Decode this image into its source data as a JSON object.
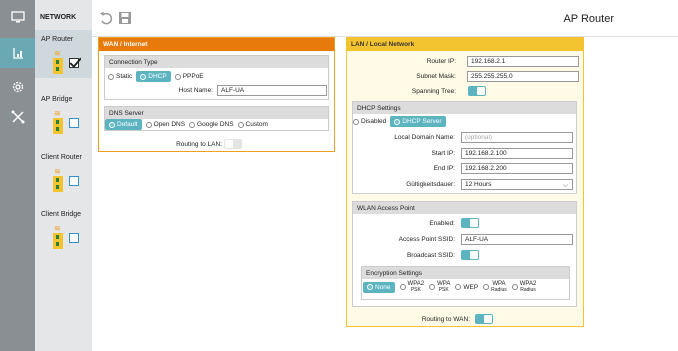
{
  "app_title": "AP Router",
  "icons": {
    "rail": [
      "monitor-icon",
      "network-icon",
      "settings-gear-icon",
      "tools-icon"
    ],
    "toolbar": [
      "undo-icon",
      "save-icon"
    ]
  },
  "sidebar": {
    "title": "NETWORK",
    "modes": [
      {
        "label": "AP Router",
        "checked": true
      },
      {
        "label": "AP Bridge",
        "checked": false
      },
      {
        "label": "Client Router",
        "checked": false
      },
      {
        "label": "Client Bridge",
        "checked": false
      }
    ]
  },
  "wan": {
    "header": "WAN / Internet",
    "connection_type": {
      "title": "Connection Type",
      "options": [
        "Static",
        "DHCP",
        "PPPoE"
      ],
      "selected": "DHCP",
      "host_name_label": "Host Name:",
      "host_name_value": "ALF-UA"
    },
    "dns": {
      "title": "DNS Server",
      "options": [
        "Default",
        "Open DNS",
        "Google DNS",
        "Custom"
      ],
      "selected": "Default"
    },
    "routing_label": "Routing to LAN:",
    "routing_on": false
  },
  "lan": {
    "header": "LAN / Local Network",
    "router_ip_label": "Router IP:",
    "router_ip": "192.168.2.1",
    "subnet_label": "Subnet Mask:",
    "subnet": "255.255.255.0",
    "spanning_label": "Spanning Tree:",
    "spanning_on": true,
    "dhcp": {
      "title": "DHCP Settings",
      "options": [
        "Disabled",
        "DHCP Server"
      ],
      "selected": "DHCP Server",
      "domain_label": "Local Domain Name:",
      "domain_placeholder": "(optional)",
      "start_label": "Start IP:",
      "start_ip": "192.168.2.100",
      "end_label": "End IP:",
      "end_ip": "192.168.2.200",
      "lease_label": "Gültigkeitsdauer:",
      "lease_value": "12 Hours"
    },
    "wlan": {
      "title": "WLAN Access Point",
      "enabled_label": "Enabled:",
      "enabled_on": true,
      "ssid_label": "Access Point SSID:",
      "ssid": "ALF-UA",
      "broadcast_label": "Broadcast SSID:",
      "broadcast_on": true,
      "encryption": {
        "title": "Encryption Settings",
        "none": "None",
        "wpa2_psk": [
          "WPA2",
          "PSK"
        ],
        "wpa_psk": [
          "WPA",
          "PSK"
        ],
        "wep": "WEP",
        "wpa_radius": [
          "WPA",
          "Radius"
        ],
        "wpa2_radius": [
          "WPA2",
          "Radius"
        ],
        "selected": "None"
      }
    },
    "routing_label": "Routing to WAN:",
    "routing_on": true
  }
}
